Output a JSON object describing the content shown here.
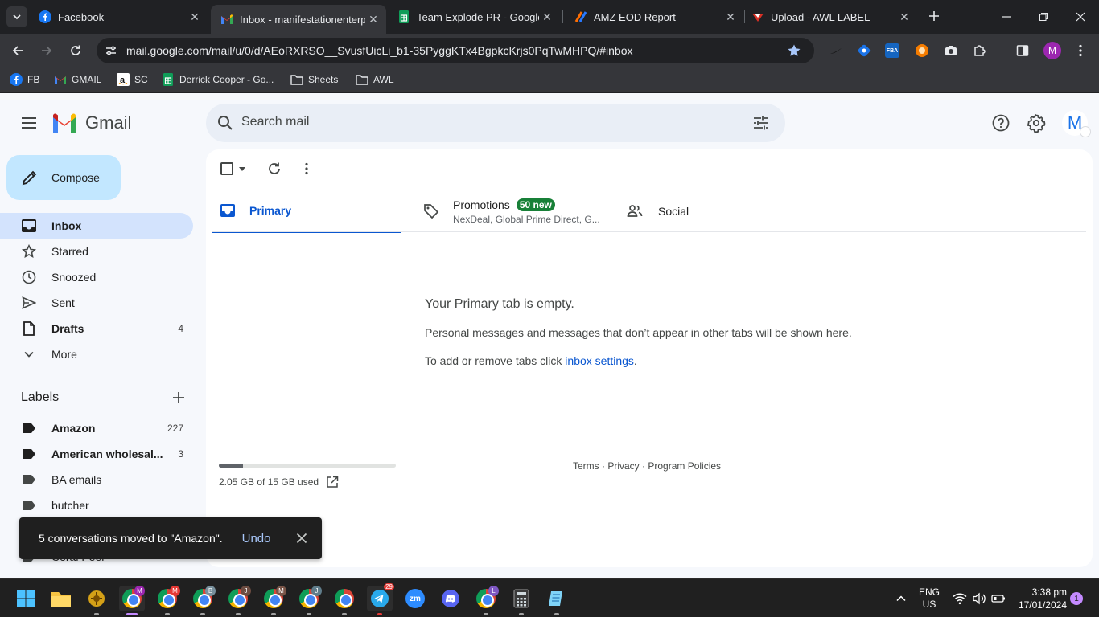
{
  "browser": {
    "tabs": [
      {
        "title": "Facebook",
        "icon": "facebook-icon",
        "active": false
      },
      {
        "title": "Inbox - manifestationenterp",
        "icon": "gmail-icon",
        "active": true
      },
      {
        "title": "Team Explode PR - Google S",
        "icon": "google-sheets-icon",
        "active": false
      },
      {
        "title": "AMZ EOD Report",
        "icon": "report-app-icon",
        "active": false
      },
      {
        "title": "Upload - AWL LABEL",
        "icon": "awl-label-icon",
        "active": false
      }
    ],
    "url": "mail.google.com/mail/u/0/d/AEoRXRSO__SvusfUicLi_b1-35PyggKTx4BgpkcKrjs0PqTwMHPQ/#inbox",
    "profile_initial": "M",
    "ext_fba_label": "FBA",
    "bookmarks": [
      {
        "label": "FB",
        "icon": "facebook-icon"
      },
      {
        "label": "GMAIL",
        "icon": "gmail-icon"
      },
      {
        "label": "SC",
        "icon": "amazon-icon"
      },
      {
        "label": "Derrick Cooper - Go...",
        "icon": "google-sheets-icon"
      },
      {
        "label": "Sheets",
        "icon": "folder-icon"
      },
      {
        "label": "AWL",
        "icon": "folder-icon"
      }
    ]
  },
  "gmail": {
    "logo_text": "Gmail",
    "search_placeholder": "Search mail",
    "account_initial": "M",
    "compose_label": "Compose",
    "nav": [
      {
        "label": "Inbox",
        "count": "",
        "icon": "inbox-icon"
      },
      {
        "label": "Starred",
        "count": "",
        "icon": "star-icon"
      },
      {
        "label": "Snoozed",
        "count": "",
        "icon": "clock-icon"
      },
      {
        "label": "Sent",
        "count": "",
        "icon": "send-icon"
      },
      {
        "label": "Drafts",
        "count": "4",
        "icon": "draft-icon"
      },
      {
        "label": "More",
        "count": "",
        "icon": "chevron-down-icon"
      }
    ],
    "labels_heading": "Labels",
    "labels": [
      {
        "label": "Amazon",
        "count": "227"
      },
      {
        "label": "American wholesal...",
        "count": "3"
      },
      {
        "label": "BA emails",
        "count": ""
      },
      {
        "label": "butcher",
        "count": ""
      },
      {
        "label": "Coral Peel",
        "count": ""
      }
    ],
    "tabs": {
      "primary": "Primary",
      "promotions": "Promotions",
      "promotions_badge": "50 new",
      "promotions_snippet": "NexDeal, Global Prime Direct, G...",
      "social": "Social"
    },
    "empty_title": "Your Primary tab is empty.",
    "empty_text": "Personal messages and messages that don’t appear in other tabs will be shown here.",
    "settings_prefix": "To add or remove tabs click ",
    "settings_link": "inbox settings",
    "settings_suffix": ".",
    "storage_text": "2.05 GB of 15 GB used",
    "storage_fraction": 0.137,
    "footer_links": [
      "Terms",
      "Privacy",
      "Program Policies"
    ],
    "footer_sep": " · ",
    "toast": {
      "message": "5 conversations moved to \"Amazon\".",
      "undo": "Undo"
    }
  },
  "taskbar": {
    "telegram_badge": "29",
    "zoom_label": "zm",
    "lang_top": "ENG",
    "lang_bottom": "US",
    "time": "3:38 pm",
    "date": "17/01/2024",
    "notifications": "1",
    "chrome_profiles": [
      "M",
      "M",
      "B",
      "J",
      "M",
      "J",
      "",
      "L"
    ]
  },
  "colors": {
    "accent_blue": "#0b57d0",
    "selected_nav": "#d3e3fd",
    "compose_bg": "#c2e7ff",
    "badge_green": "#188038"
  }
}
